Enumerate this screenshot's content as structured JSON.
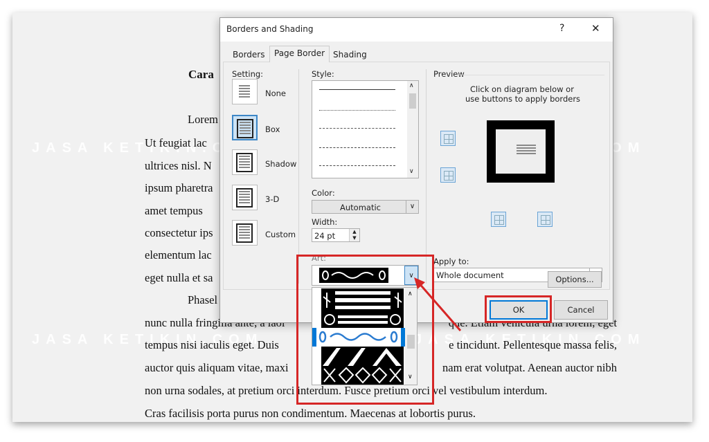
{
  "watermark": "JASA KETIKIN.COM",
  "document": {
    "heading": "Cara",
    "lines": [
      {
        "left": "Lorem"
      },
      {
        "left": "Ut feugiat lac"
      },
      {
        "left": "ultrices nisl. N"
      },
      {
        "left": "ipsum pharetra"
      },
      {
        "left": "amet  tempus"
      },
      {
        "left": "consectetur ips"
      },
      {
        "left": "elementum lac"
      },
      {
        "left": "eget nulla et sa"
      },
      {
        "left": "Phasel"
      },
      {
        "left": "nunc nulla fringilla ante, a laoi",
        "right": "que. Etiam vehicula urna lorem, eget"
      },
      {
        "left": "tempus nisi iaculis eget. Duis",
        "right": "e tincidunt. Pellentesque massa felis,"
      },
      {
        "left": "auctor quis aliquam vitae, maxi",
        "right": "nam erat volutpat. Aenean auctor nibh"
      },
      {
        "left": "non urna sodales, at pretium orci interdum. Fusce pretium orci vel vestibulum interdum."
      },
      {
        "left": "Cras facilisis porta purus non condimentum. Maecenas at lobortis purus."
      }
    ]
  },
  "dialog": {
    "title": "Borders and Shading",
    "help": "?",
    "close": "✕",
    "tabs": [
      {
        "label": "Borders"
      },
      {
        "label": "Page Border",
        "active": true
      },
      {
        "label": "Shading"
      }
    ],
    "setting": {
      "label": "Setting:",
      "items": [
        {
          "label": "None"
        },
        {
          "label": "Box",
          "selected": true
        },
        {
          "label": "Shadow"
        },
        {
          "label": "3-D"
        },
        {
          "label": "Custom"
        }
      ]
    },
    "style": {
      "label": "Style:",
      "options": [
        "solid",
        "dotted",
        "dashed-small",
        "dashed",
        "dash-dot"
      ]
    },
    "color": {
      "label": "Color:",
      "value": "Automatic"
    },
    "width": {
      "label": "Width:",
      "value": "24 pt"
    },
    "art": {
      "label": "Art:",
      "selected_index": 2
    },
    "preview": {
      "label": "Preview",
      "hint1": "Click on diagram below or",
      "hint2": "use buttons to apply borders"
    },
    "apply_to": {
      "label": "Apply to:",
      "value": "Whole document"
    },
    "options_button": "Options...",
    "ok_button": "OK",
    "cancel_button": "Cancel"
  },
  "colors": {
    "highlight": "#d62626",
    "selection": "#3c86c6"
  }
}
